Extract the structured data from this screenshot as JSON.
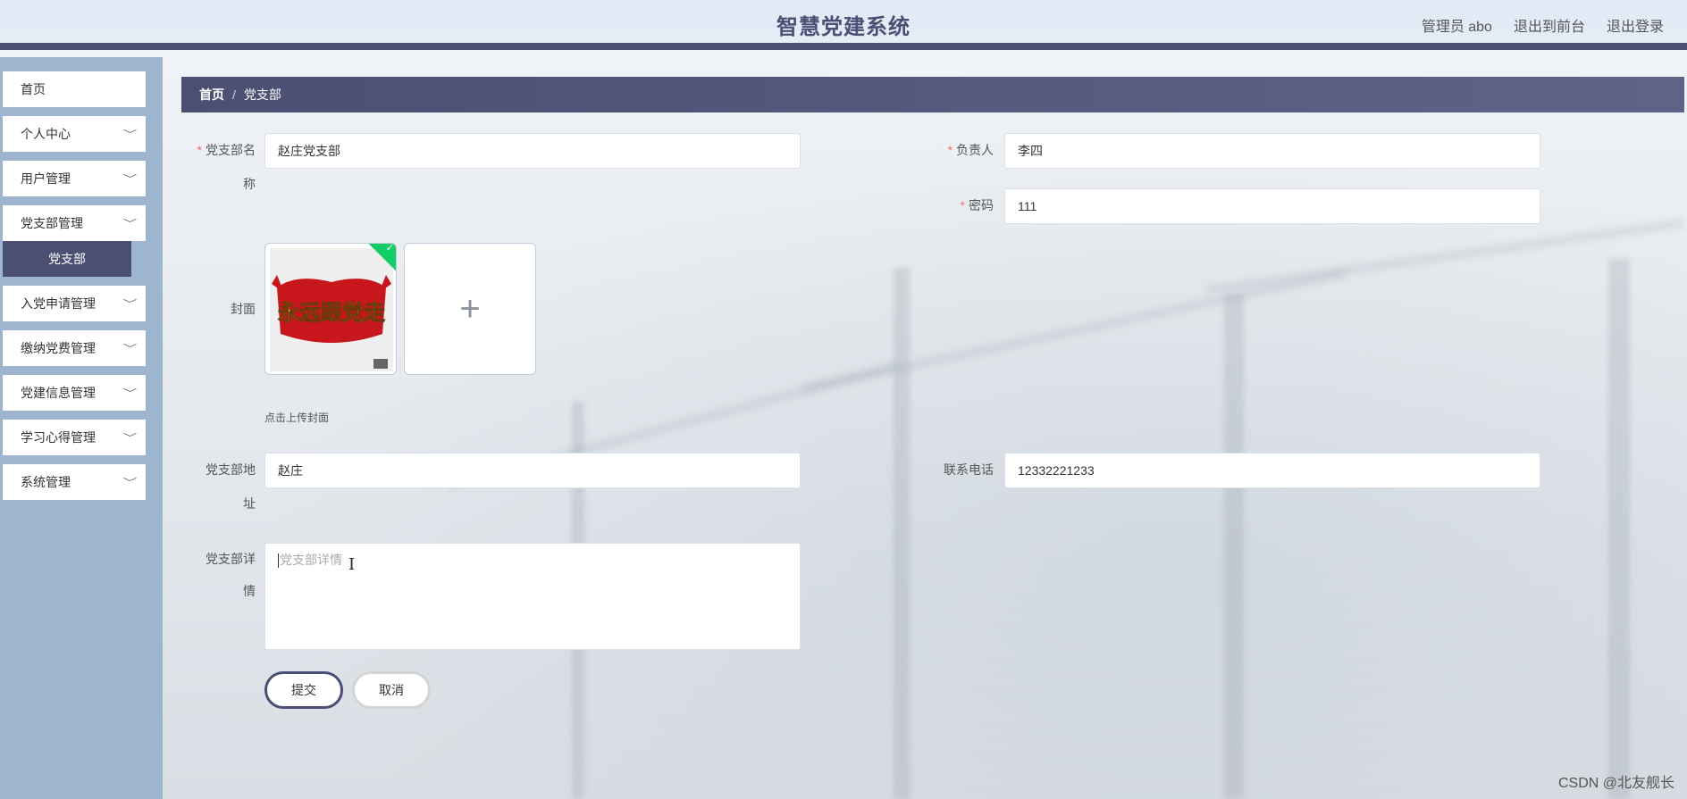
{
  "header": {
    "title": "智慧党建系统",
    "admin_label": "管理员 abo",
    "front_label": "退出到前台",
    "logout_label": "退出登录"
  },
  "sidebar": {
    "items": [
      {
        "label": "首页"
      },
      {
        "label": "个人中心"
      },
      {
        "label": "用户管理"
      },
      {
        "label": "党支部管理"
      },
      {
        "label": "入党申请管理"
      },
      {
        "label": "缴纳党费管理"
      },
      {
        "label": "党建信息管理"
      },
      {
        "label": "学习心得管理"
      },
      {
        "label": "系统管理"
      }
    ],
    "active_sub": "党支部"
  },
  "breadcrumb": {
    "home": "首页",
    "separator": "/",
    "current": "党支部"
  },
  "form": {
    "branch_name_label_line1": "党支部名",
    "branch_name_label_line2": "称",
    "branch_name_value": "赵庄党支部",
    "leader_label": "负责人",
    "leader_value": "李四",
    "password_label": "密码",
    "password_value": "111",
    "cover_label": "封面",
    "cover_tip": "点击上传封面",
    "cover_image_text": "永远跟党走",
    "address_label_line1": "党支部地",
    "address_label_line2": "址",
    "address_value": "赵庄",
    "phone_label": "联系电话",
    "phone_value": "12332221233",
    "detail_label_line1": "党支部详",
    "detail_label_line2": "情",
    "detail_placeholder": "党支部详情",
    "required_mark": "*",
    "plus_glyph": "+",
    "check_glyph": "✓"
  },
  "buttons": {
    "submit": "提交",
    "cancel": "取消"
  },
  "watermark": "CSDN @北友舰长",
  "colors": {
    "primary": "#4b4f72",
    "sidebar_bg": "#9eb5cf",
    "required": "#f56c6c",
    "success": "#13ce66"
  }
}
